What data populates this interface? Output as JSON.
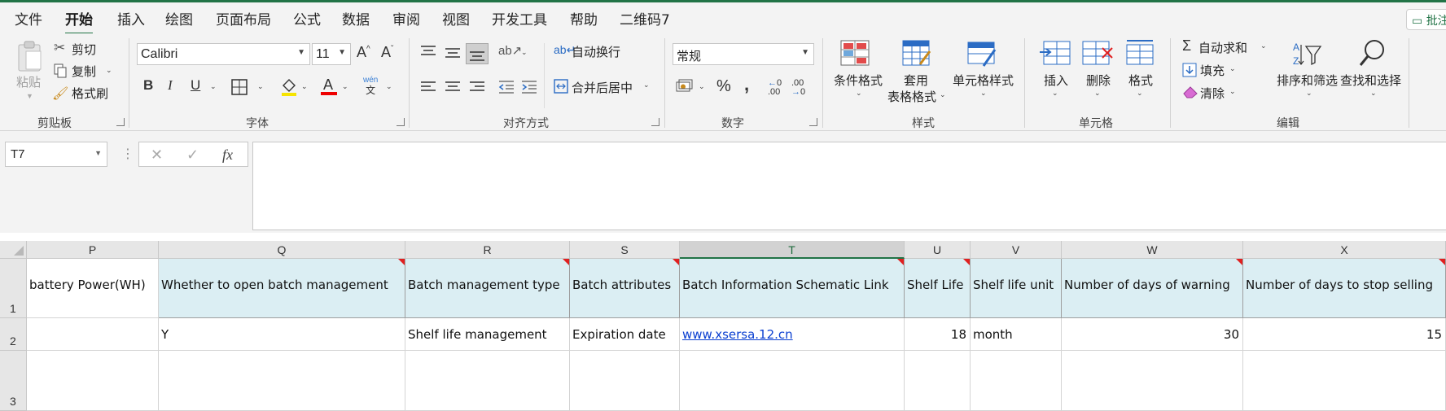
{
  "menu": {
    "tabs": [
      "文件",
      "开始",
      "插入",
      "绘图",
      "页面布局",
      "公式",
      "数据",
      "审阅",
      "视图",
      "开发工具",
      "帮助",
      "二维码7"
    ],
    "active_index": 1,
    "comment_button": "批注"
  },
  "ribbon": {
    "clipboard": {
      "paste": "粘贴",
      "cut": "剪切",
      "copy": "复制",
      "format_painter": "格式刷",
      "group_label": "剪贴板"
    },
    "font": {
      "font_name": "Calibri",
      "font_size": "11",
      "grow": "A^",
      "shrink": "A˅",
      "bold": "B",
      "italic": "I",
      "underline": "U",
      "wen": "wén",
      "wen_char": "文",
      "group_label": "字体"
    },
    "alignment": {
      "wrap_text": "自动换行",
      "merge_center": "合并后居中",
      "group_label": "对齐方式"
    },
    "number": {
      "format": "常规",
      "percent": "%",
      "comma": "9",
      "dec_inc": "←0 .00",
      "dec_dec": ".00 →0",
      "group_label": "数字"
    },
    "styles": {
      "conditional": "条件格式",
      "table_format_line1": "套用",
      "table_format_line2": "表格格式",
      "cell_styles": "单元格样式",
      "group_label": "样式"
    },
    "cells": {
      "insert": "插入",
      "delete": "删除",
      "format": "格式",
      "group_label": "单元格"
    },
    "editing": {
      "autosum": "自动求和",
      "fill": "填充",
      "clear": "清除",
      "sort_filter": "排序和筛选",
      "find_select": "查找和选择",
      "group_label": "编辑"
    }
  },
  "formula_bar": {
    "name_box": "T7",
    "cancel": "✕",
    "enter": "✓",
    "fx": "fx",
    "formula": ""
  },
  "sheet": {
    "columns": [
      "P",
      "Q",
      "R",
      "S",
      "T",
      "U",
      "V",
      "W",
      "X"
    ],
    "selected_column": "T",
    "rows": [
      "1",
      "2",
      "3"
    ],
    "header_row": [
      "battery Power(WH)",
      "Whether to open batch management",
      "Batch management type",
      "Batch attributes",
      "Batch Information Schematic Link",
      "Shelf Life",
      "Shelf life unit",
      "Number of days of warning",
      "Number of days to stop selling"
    ],
    "data_row": [
      "",
      "Y",
      "Shelf life management",
      "Expiration date",
      "www.xsersa.12.cn",
      "18",
      "month",
      "30",
      "15"
    ]
  }
}
